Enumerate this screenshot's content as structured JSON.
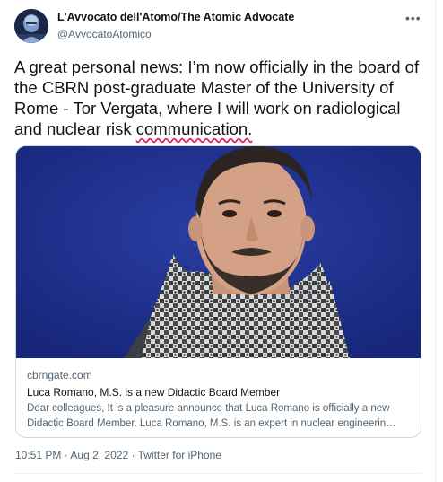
{
  "author": {
    "display_name": "L'Avvocato dell'Atomo/The Atomic Advocate",
    "handle": "@AvvocatoAtomico"
  },
  "tweet": {
    "text_before": "A great personal news: I’m now officially in the board of the CBRN post-graduate Master of the University of Rome - Tor Vergata, where I will work on radiological and nuclear risk ",
    "text_underlined": "communication."
  },
  "card": {
    "domain": "cbrngate.com",
    "title": "Luca Romano, M.S. is a new Didactic Board Member",
    "description": "Dear colleagues, It is a pleasure announce that Luca Romano is officially a new Didactic Board Member. Luca Romano, M.S. is an expert in nuclear engineerin…"
  },
  "meta": {
    "time": "10:51 PM",
    "sep1": " · ",
    "date": "Aug 2, 2022",
    "sep2": " · ",
    "source": "Twitter for iPhone"
  },
  "icons": {
    "more": "more-horizontal-icon",
    "avatar": "avatar"
  },
  "colors": {
    "text": "#0f1419",
    "secondary": "#536471",
    "card_background": "#1d2f8a",
    "spellcheck": "#e0245e"
  }
}
